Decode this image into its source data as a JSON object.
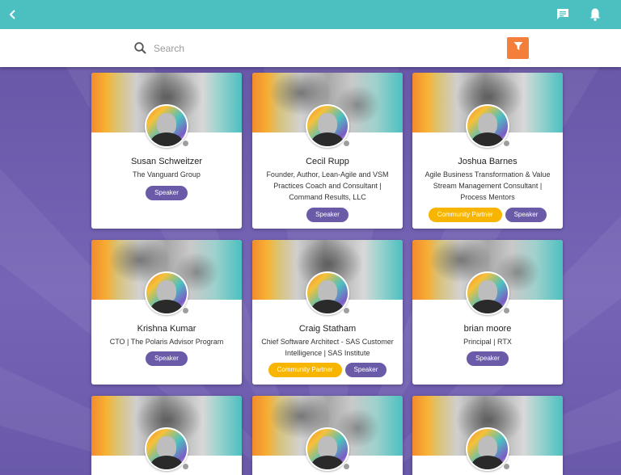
{
  "colors": {
    "topbar": "#4cc0c0",
    "accent_orange": "#f47f3a",
    "speaker_badge": "#6a5aa8",
    "partner_badge": "#f7b500",
    "background": "#6a5aa8"
  },
  "icons": {
    "back": "chevron-left-icon",
    "chat": "chat-icon",
    "notifications": "bell-icon",
    "search": "search-icon",
    "filter": "filter-icon"
  },
  "search": {
    "placeholder": "Search",
    "value": ""
  },
  "people": [
    {
      "name": "Susan Schweitzer",
      "title": "The Vanguard Group",
      "badges": [
        "Speaker"
      ]
    },
    {
      "name": "Cecil Rupp",
      "title": "Founder, Author, Lean-Agile and VSM Practices Coach and Consultant | Command Results, LLC",
      "badges": [
        "Speaker"
      ]
    },
    {
      "name": "Joshua Barnes",
      "title": "Agile Business Transformation & Value Stream Management Consultant | Process Mentors",
      "badges": [
        "Community Partner",
        "Speaker"
      ]
    },
    {
      "name": "Krishna Kumar",
      "title": "CTO | The Polaris Advisor Program",
      "badges": [
        "Speaker"
      ]
    },
    {
      "name": "Craig Statham",
      "title": "Chief Software Architect - SAS Customer Intelligence | SAS Institute",
      "badges": [
        "Community Partner",
        "Speaker"
      ]
    },
    {
      "name": "brian moore",
      "title": "Principal | RTX",
      "badges": [
        "Speaker"
      ]
    },
    {
      "name": "",
      "title": "",
      "badges": []
    },
    {
      "name": "",
      "title": "",
      "badges": []
    },
    {
      "name": "",
      "title": "",
      "badges": []
    }
  ]
}
